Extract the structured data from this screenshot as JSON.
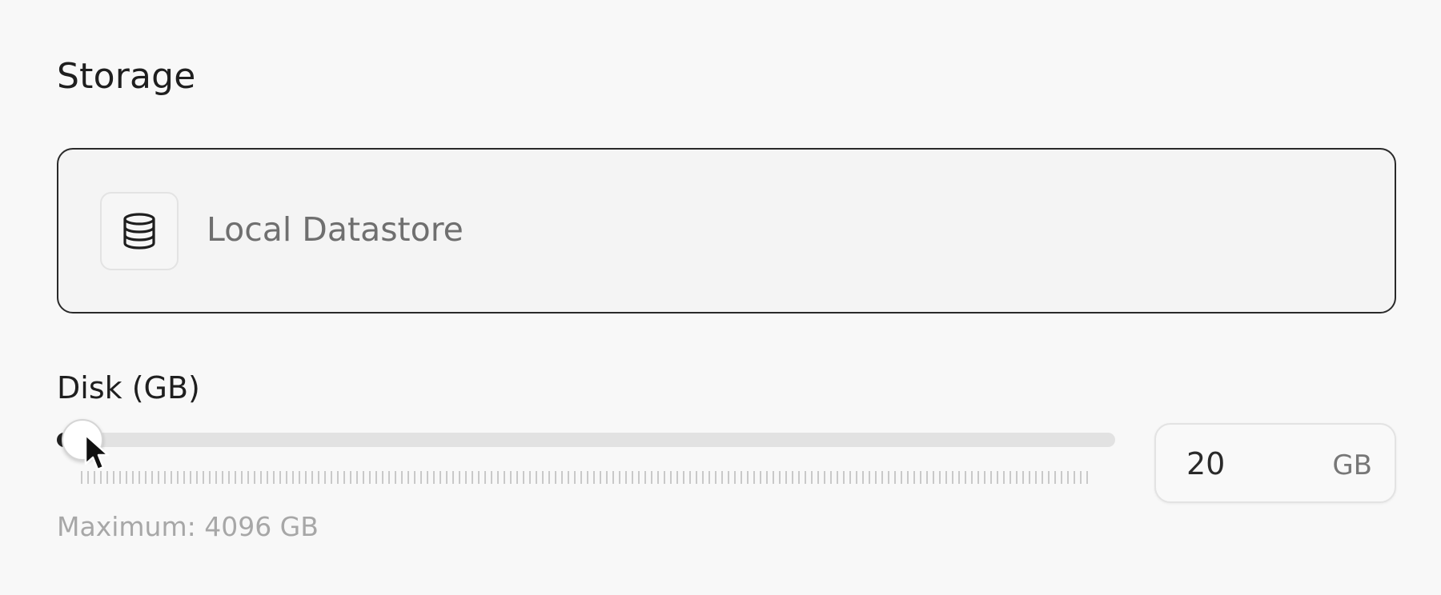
{
  "storage": {
    "title": "Storage",
    "datastore": {
      "icon": "database-icon",
      "label": "Local Datastore"
    }
  },
  "disk": {
    "label": "Disk (GB)",
    "slider": {
      "value": 20,
      "min": 0,
      "max": 4096
    },
    "input": {
      "value": "20",
      "unit": "GB"
    },
    "maximum_text": "Maximum: 4096 GB"
  },
  "colors": {
    "card_border": "#2a2a2a",
    "track": "#e2e2e2",
    "fill": "#222222",
    "muted_text": "#a7a7a7"
  }
}
